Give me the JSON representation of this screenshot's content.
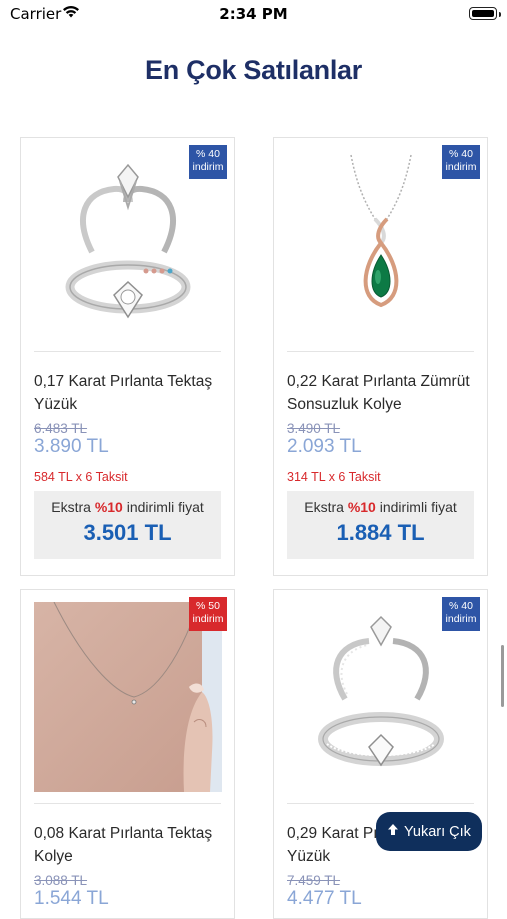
{
  "status_bar": {
    "carrier": "Carrier",
    "time": "2:34 PM"
  },
  "page": {
    "title": "En Çok Satılanlar"
  },
  "products": [
    {
      "badge_pct": "% 40",
      "badge_text": "indirim",
      "badge_color": "#2e55a6",
      "name": "0,17 Karat Pırlanta Tektaş Yüzük",
      "old_price": "6.483 TL",
      "price": "3.890 TL",
      "installment": "584 TL x 6 Taksit",
      "extra_prefix": "Ekstra ",
      "extra_pct": "%10",
      "extra_suffix": " indirimli fiyat",
      "extra_price": "3.501 TL",
      "image_icon": "solitaire-ring-icon"
    },
    {
      "badge_pct": "% 40",
      "badge_text": "indirim",
      "badge_color": "#2e55a6",
      "name": "0,22 Karat Pırlanta Zümrüt Sonsuzluk Kolye",
      "old_price": "3.490 TL",
      "price": "2.093 TL",
      "installment": "314 TL x 6 Taksit",
      "extra_prefix": "Ekstra ",
      "extra_pct": "%10",
      "extra_suffix": " indirimli fiyat",
      "extra_price": "1.884 TL",
      "image_icon": "emerald-necklace-icon"
    },
    {
      "badge_pct": "% 50",
      "badge_text": "indirim",
      "badge_color": "#d8292c",
      "name": "0,08 Karat Pırlanta Tektaş Kolye",
      "old_price": "3.088 TL",
      "price": "1.544 TL",
      "image_icon": "necklace-model-photo"
    },
    {
      "badge_pct": "% 40",
      "badge_text": "indirim",
      "badge_color": "#2e55a6",
      "name": "0,29 Karat Pırlanta Tektaş Yüzük",
      "old_price": "7.459 TL",
      "price": "4.477 TL",
      "image_icon": "pave-ring-icon"
    }
  ],
  "scroll_top_button": {
    "label": "Yukarı Çık",
    "icon": "arrow-up-icon"
  }
}
